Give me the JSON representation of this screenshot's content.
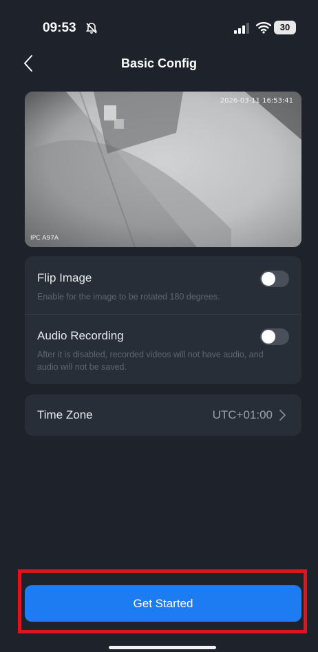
{
  "status_bar": {
    "time": "09:53",
    "battery": "30",
    "icons": [
      "bell-slash-icon",
      "signal-icon",
      "wifi-icon",
      "battery-icon"
    ]
  },
  "header": {
    "title": "Basic Config",
    "back_icon": "chevron-left-icon"
  },
  "preview": {
    "timestamp": "2026-03-11 16:53:41",
    "camera_label": "IPC A97A"
  },
  "settings": {
    "flip_image": {
      "label": "Flip Image",
      "description": "Enable for the image to be rotated 180 degrees.",
      "enabled": false
    },
    "audio_recording": {
      "label": "Audio Recording",
      "description": "After it is disabled, recorded videos will not have audio, and audio will not be saved.",
      "enabled": false
    },
    "time_zone": {
      "label": "Time Zone",
      "value": "UTC+01:00"
    }
  },
  "footer": {
    "primary_button": "Get Started"
  },
  "colors": {
    "background": "#1e232b",
    "card": "#282e37",
    "accent": "#1e7cf2",
    "highlight": "#e0141e"
  }
}
